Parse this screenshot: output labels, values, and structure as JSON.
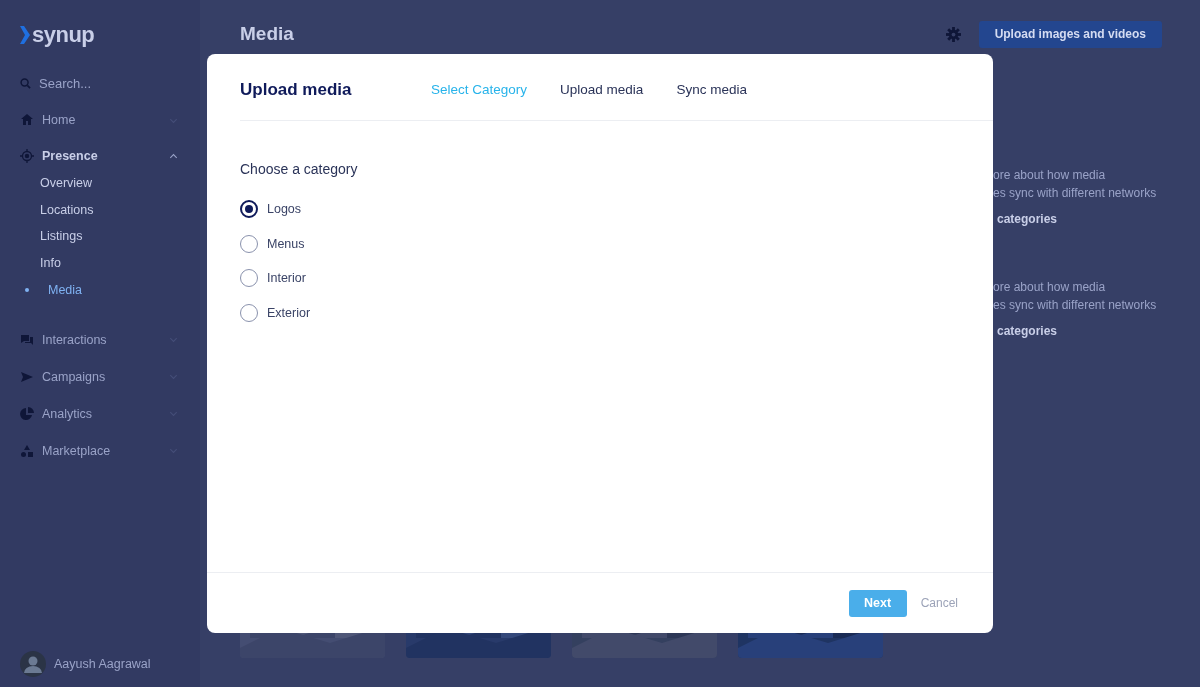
{
  "sidebar": {
    "logo": "synup",
    "search": {
      "placeholder": "Search..."
    },
    "items": [
      {
        "label": "Home",
        "expanded": false
      },
      {
        "label": "Presence",
        "expanded": true,
        "children": [
          {
            "label": "Overview",
            "selected": false
          },
          {
            "label": "Locations",
            "selected": false
          },
          {
            "label": "Listings",
            "selected": false
          },
          {
            "label": "Info",
            "selected": false
          },
          {
            "label": "Media",
            "selected": true
          }
        ]
      },
      {
        "label": "Interactions",
        "expanded": false
      },
      {
        "label": "Campaigns",
        "expanded": false
      },
      {
        "label": "Analytics",
        "expanded": false
      },
      {
        "label": "Marketplace",
        "expanded": false
      }
    ],
    "user": {
      "name": "Aayush Aagrawal"
    }
  },
  "page": {
    "title": "Media",
    "upload_button": "Upload images and videos",
    "info_cards": [
      {
        "line_1": "ore about how media",
        "line_2": "es sync with different networks",
        "link": "categories"
      },
      {
        "line_1": "ore about how media",
        "line_2": "es sync with different networks",
        "link": "categories"
      }
    ]
  },
  "modal": {
    "title": "Upload media",
    "tabs": [
      {
        "label": "Select Category",
        "selected": true
      },
      {
        "label": "Upload media",
        "selected": false
      },
      {
        "label": "Sync media",
        "selected": false
      }
    ],
    "prompt": "Choose a category",
    "options": [
      {
        "label": "Logos",
        "selected": true
      },
      {
        "label": "Menus",
        "selected": false
      },
      {
        "label": "Interior",
        "selected": false
      },
      {
        "label": "Exterior",
        "selected": false
      }
    ],
    "buttons": {
      "primary": "Next",
      "secondary": "Cancel"
    }
  }
}
